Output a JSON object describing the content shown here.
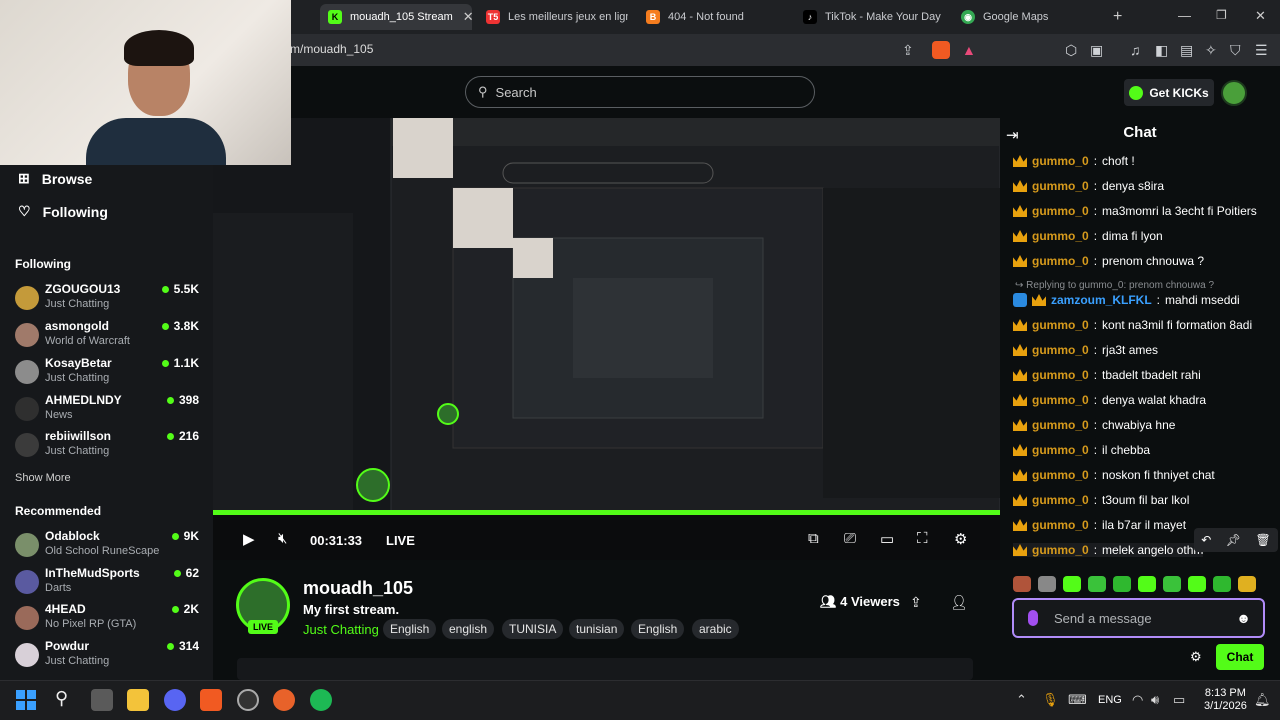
{
  "browser": {
    "tabs": [
      {
        "label": "mouadh_105 Stream",
        "favicon": "K",
        "active": true
      },
      {
        "label": "Les meilleurs jeux en ligne",
        "favicon": "T5",
        "active": false
      },
      {
        "label": "404 - Not found",
        "favicon": "B",
        "active": false
      },
      {
        "label": "TikTok - Make Your Day",
        "favicon": "♪",
        "active": false
      },
      {
        "label": "Google Maps",
        "favicon": "◉",
        "active": false
      }
    ],
    "url": "m/mouadh_105",
    "new_tab": "+"
  },
  "header": {
    "search_placeholder": "Search",
    "get_kicks": "Get KICKs"
  },
  "sidebar": {
    "browse": "Browse",
    "following_nav": "Following",
    "following_heading": "Following",
    "following": [
      {
        "name": "ZGOUGOU13",
        "category": "Just Chatting",
        "viewers": "5.5K"
      },
      {
        "name": "asmongold",
        "category": "World of Warcraft",
        "viewers": "3.8K"
      },
      {
        "name": "KosayBetar",
        "category": "Just Chatting",
        "viewers": "1.1K"
      },
      {
        "name": "AHMEDLNDY",
        "category": "News",
        "viewers": "398"
      },
      {
        "name": "rebiiwillson",
        "category": "Just Chatting",
        "viewers": "216"
      }
    ],
    "show_more": "Show More",
    "recommended_heading": "Recommended",
    "recommended": [
      {
        "name": "Odablock",
        "category": "Old School RuneScape",
        "viewers": "9K"
      },
      {
        "name": "InTheMudSports",
        "category": "Darts",
        "viewers": "62"
      },
      {
        "name": "4HEAD",
        "category": "No Pixel RP (GTA)",
        "viewers": "2K"
      },
      {
        "name": "Powdur",
        "category": "Just Chatting",
        "viewers": "314"
      }
    ]
  },
  "player": {
    "time": "00:31:33",
    "live": "LIVE"
  },
  "stream": {
    "name": "mouadh_105",
    "live_badge": "LIVE",
    "title": "My first stream.",
    "category": "Just Chatting",
    "tags": [
      "English",
      "english",
      "TUNISIA",
      "tunisian",
      "English",
      "arabic"
    ],
    "viewers": "4 Viewers"
  },
  "chat": {
    "title": "Chat",
    "messages": [
      {
        "user": "gummo_0",
        "text": "choft !"
      },
      {
        "user": "gummo_0",
        "text": "denya s8ira"
      },
      {
        "user": "gummo_0",
        "text": "ma3momri la 3echt fi Poitiers"
      },
      {
        "user": "gummo_0",
        "text": "dima fi lyon"
      },
      {
        "user": "gummo_0",
        "text": "prenom chnouwa ?"
      }
    ],
    "reply_context": "Replying to gummo_0: prenom chnouwa ?",
    "reply_message": {
      "user": "zamzoum_KLFKL",
      "text": "mahdi mseddi"
    },
    "messages_after": [
      {
        "user": "gummo_0",
        "text": "kont na3mil fi formation 8adi"
      },
      {
        "user": "gummo_0",
        "text": "rja3t ames"
      },
      {
        "user": "gummo_0",
        "text": "tbadelt tbadelt rahi"
      },
      {
        "user": "gummo_0",
        "text": "denya walat khadra"
      },
      {
        "user": "gummo_0",
        "text": "chwabiya hne"
      },
      {
        "user": "gummo_0",
        "text": "il chebba"
      },
      {
        "user": "gummo_0",
        "text": "noskon fi thniyet chat"
      },
      {
        "user": "gummo_0",
        "text": "t3oum fil bar lkol"
      },
      {
        "user": "gummo_0",
        "text": "ila b7ar il mayet"
      },
      {
        "user": "gummo_0",
        "text": "melek angelo othman"
      }
    ],
    "input_placeholder": "Send a message",
    "send_label": "Chat"
  },
  "taskbar": {
    "language": "ENG",
    "time": "8:13 PM",
    "date": "3/1/2026"
  },
  "colors": {
    "kick_green": "#53fc18",
    "gummo_color": "#d69a1c",
    "zamzoum_color": "#3aa0ff"
  }
}
